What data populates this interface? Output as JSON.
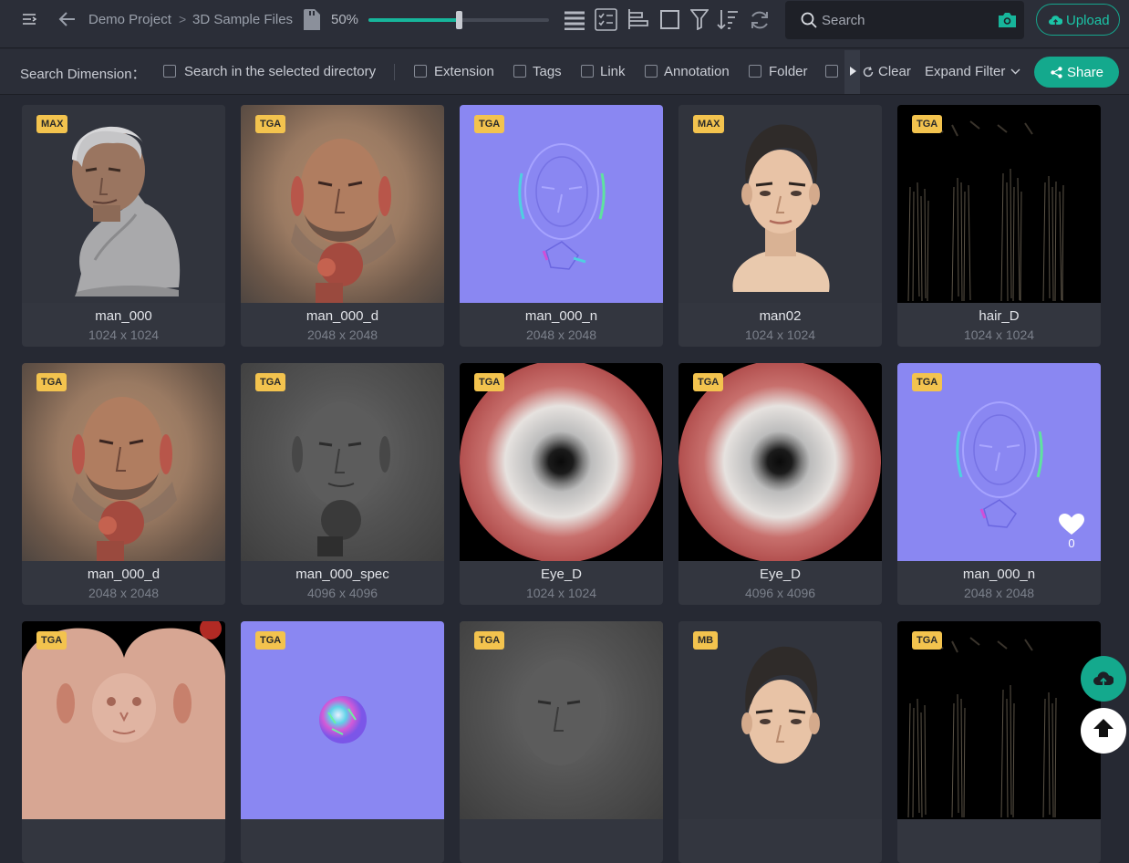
{
  "header": {
    "breadcrumb": [
      "Demo Project",
      "3D Sample Files"
    ],
    "zoom_label": "50%",
    "zoom_value": 0.5,
    "search_placeholder": "Search",
    "upload_label": "Upload"
  },
  "filter": {
    "dimension_label": "Search Dimension：",
    "options": [
      "Search in the selected directory",
      "Extension",
      "Tags",
      "Link",
      "Annotation",
      "Folder"
    ],
    "clear_label": "Clear",
    "expand_label": "Expand Filter",
    "share_label": "Share"
  },
  "colors": {
    "accent": "#17b59b",
    "badge": "#f3c34e",
    "background": "#262933",
    "card": "#33363f"
  },
  "files": [
    {
      "name": "man_000",
      "dims": "1024 x 1024",
      "badge": "MAX"
    },
    {
      "name": "man_000_d",
      "dims": "2048 x 2048",
      "badge": "TGA"
    },
    {
      "name": "man_000_n",
      "dims": "2048 x 2048",
      "badge": "TGA"
    },
    {
      "name": "man02",
      "dims": "1024 x 1024",
      "badge": "MAX"
    },
    {
      "name": "hair_D",
      "dims": "1024 x 1024",
      "badge": "TGA"
    },
    {
      "name": "man_000_d",
      "dims": "2048 x 2048",
      "badge": "TGA"
    },
    {
      "name": "man_000_spec",
      "dims": "4096 x 4096",
      "badge": "TGA"
    },
    {
      "name": "Eye_D",
      "dims": "1024 x 1024",
      "badge": "TGA"
    },
    {
      "name": "Eye_D",
      "dims": "4096 x 4096",
      "badge": "TGA"
    },
    {
      "name": "man_000_n",
      "dims": "2048 x 2048",
      "badge": "TGA",
      "likes": "0"
    },
    {
      "badge": "TGA"
    },
    {
      "badge": "TGA"
    },
    {
      "badge": "TGA"
    },
    {
      "badge": "MB"
    },
    {
      "badge": "TGA"
    }
  ]
}
